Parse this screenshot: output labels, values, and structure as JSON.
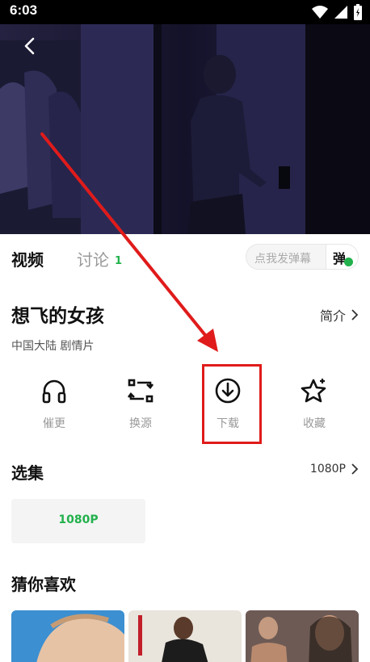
{
  "status_bar": {
    "time": "6:03"
  },
  "video": {
    "back_icon": "chevron-left-icon"
  },
  "tabs": {
    "video_label": "视频",
    "discuss_label": "讨论",
    "discuss_count": "1",
    "danmaku_placeholder": "点我发弹幕",
    "danmaku_toggle_label": "弹"
  },
  "detail": {
    "title": "想飞的女孩",
    "intro_label": "简介",
    "tags": "中国大陆  剧情片"
  },
  "actions": [
    {
      "label": "催更",
      "icon": "headphones-icon"
    },
    {
      "label": "换源",
      "icon": "switch-source-icon"
    },
    {
      "label": "下载",
      "icon": "download-icon"
    },
    {
      "label": "收藏",
      "icon": "star-icon"
    }
  ],
  "episodes": {
    "title": "选集",
    "quality_label": "1080P",
    "items": [
      "1080P"
    ]
  },
  "recommend": {
    "title": "猜你喜欢"
  },
  "colors": {
    "accent_green": "#22b14c",
    "annotation_red": "#e01b1b"
  }
}
